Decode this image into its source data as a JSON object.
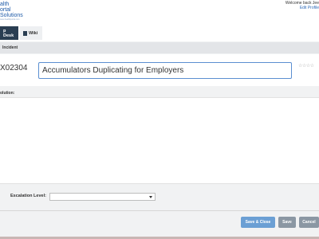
{
  "header": {
    "logo": {
      "line1": "alth",
      "line2": "ortal",
      "line3": "Solutions",
      "tagline": "www.healthportal.com"
    },
    "welcome_text": "Welcome back Jee",
    "edit_profile": "Edit Profile"
  },
  "tabs": [
    {
      "label": "p Desk",
      "active": true
    },
    {
      "label": "Wiki",
      "active": false,
      "icon": "wiki-icon"
    }
  ],
  "incident_section": {
    "label": "Incident"
  },
  "record": {
    "id": "X02304",
    "title_value": "Accumulators Duplicating for Employers",
    "rating": "☆☆☆☆"
  },
  "resolution": {
    "label": "olution:"
  },
  "escalation": {
    "label": "Escalation Level:",
    "selected": ""
  },
  "buttons": {
    "save_close": "Save & Close",
    "save": "Save",
    "cancel": "Cancel"
  },
  "colors": {
    "active_tab": "#2a3e52",
    "primary_button": "#6b9fd4",
    "secondary_button": "#8b97a3",
    "input_border": "#5b8fd1"
  }
}
